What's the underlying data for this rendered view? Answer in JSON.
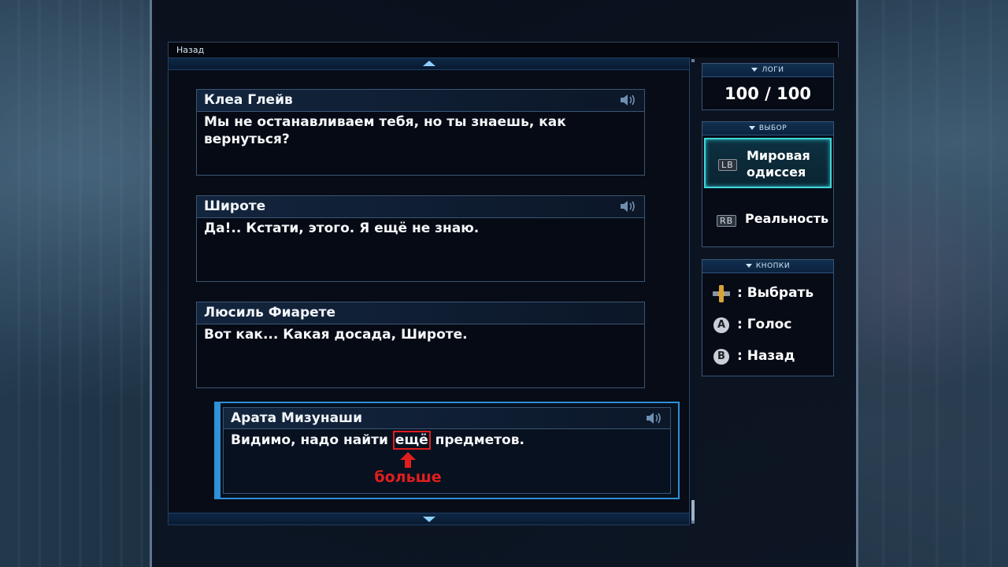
{
  "nav": {
    "back_label": "Назад"
  },
  "log_entries": [
    {
      "speaker": "Клеа Глейв",
      "text": "Мы не останавливаем тебя, но ты знаешь, как вернуться?"
    },
    {
      "speaker": "Широте",
      "text": "Да!.. Кстати, этого. Я ещё не знаю."
    },
    {
      "speaker": "Люсиль Фиарете",
      "text": "Вот как... Какая досада, Широте."
    }
  ],
  "active_entry": {
    "speaker": "Арата Мизунаши",
    "text_before": "Видимо, надо найти ",
    "text_highlight": "ещё",
    "text_after": " предметов."
  },
  "annotation": {
    "label": "больше",
    "color": "#e01e1e"
  },
  "logs_panel": {
    "header": "ЛОГИ",
    "count": "100 / 100"
  },
  "choice_panel": {
    "header": "ВЫБОР",
    "options": [
      {
        "button": "LB",
        "label": "Мировая одиссея",
        "selected": true
      },
      {
        "button": "RB",
        "label": "Реальность",
        "selected": false
      }
    ]
  },
  "buttons_panel": {
    "header": "КНОПКИ",
    "items": [
      {
        "icon": "dpad-icon",
        "label": ": Выбрать"
      },
      {
        "icon": "a-button-icon",
        "glyph": "A",
        "label": ": Голос"
      },
      {
        "icon": "b-button-icon",
        "glyph": "B",
        "label": ": Назад"
      }
    ]
  },
  "colors": {
    "accent": "#2c8fd8",
    "selected": "#3fd6d8",
    "highlight": "#e01e1e"
  }
}
